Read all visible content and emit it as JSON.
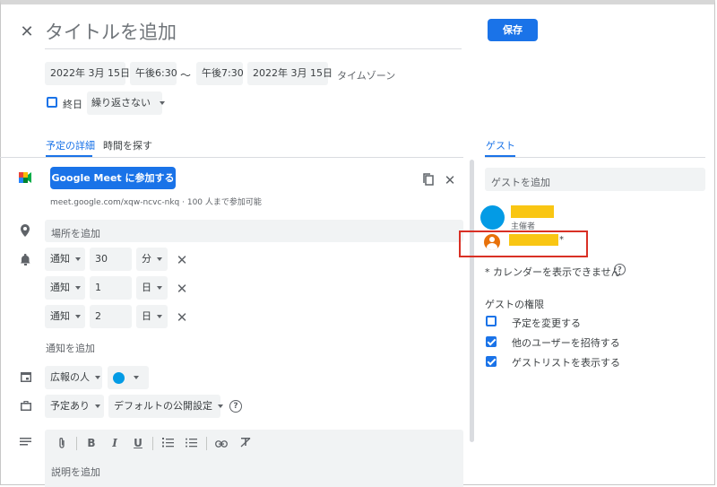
{
  "header": {
    "title_placeholder": "タイトルを追加",
    "save_label": "保存"
  },
  "datetime": {
    "start_date": "2022年 3月 15日",
    "start_time": "午後6:30",
    "separator": "〜",
    "end_time": "午後7:30",
    "end_date": "2022年 3月 15日",
    "timezone_label": "タイムゾーン",
    "all_day_label": "終日",
    "repeat_value": "繰り返さない"
  },
  "tabs": {
    "details": "予定の詳細",
    "find_time": "時間を探す",
    "guests": "ゲスト"
  },
  "meet": {
    "join_label": "Google Meet に参加する",
    "link_info": "meet.google.com/xqw-ncvc-nkq · 100 人まで参加可能"
  },
  "location": {
    "placeholder": "場所を追加"
  },
  "notifications": {
    "items": [
      {
        "type": "通知",
        "value": "30",
        "unit": "分"
      },
      {
        "type": "通知",
        "value": "1",
        "unit": "日"
      },
      {
        "type": "通知",
        "value": "2",
        "unit": "日"
      }
    ],
    "add_label": "通知を追加"
  },
  "calendar": {
    "owner": "広報の人",
    "color": "#039be5"
  },
  "availability": {
    "busy": "予定あり",
    "visibility": "デフォルトの公開設定"
  },
  "description": {
    "placeholder": "説明を追加"
  },
  "guests": {
    "add_placeholder": "ゲストを追加",
    "organizer_label": "主催者",
    "asterisk": "*",
    "warning": "* カレンダーを表示できません",
    "permissions_title": "ゲストの権限",
    "permissions": [
      {
        "label": "予定を変更する",
        "checked": false
      },
      {
        "label": "他のユーザーを招待する",
        "checked": true
      },
      {
        "label": "ゲストリストを表示する",
        "checked": true
      }
    ]
  },
  "colors": {
    "accent": "#1a73e8",
    "highlight_box": "#d93025",
    "redaction": "#f9c613",
    "avatar_org": "#039be5",
    "avatar_guest": "#e8710a"
  }
}
